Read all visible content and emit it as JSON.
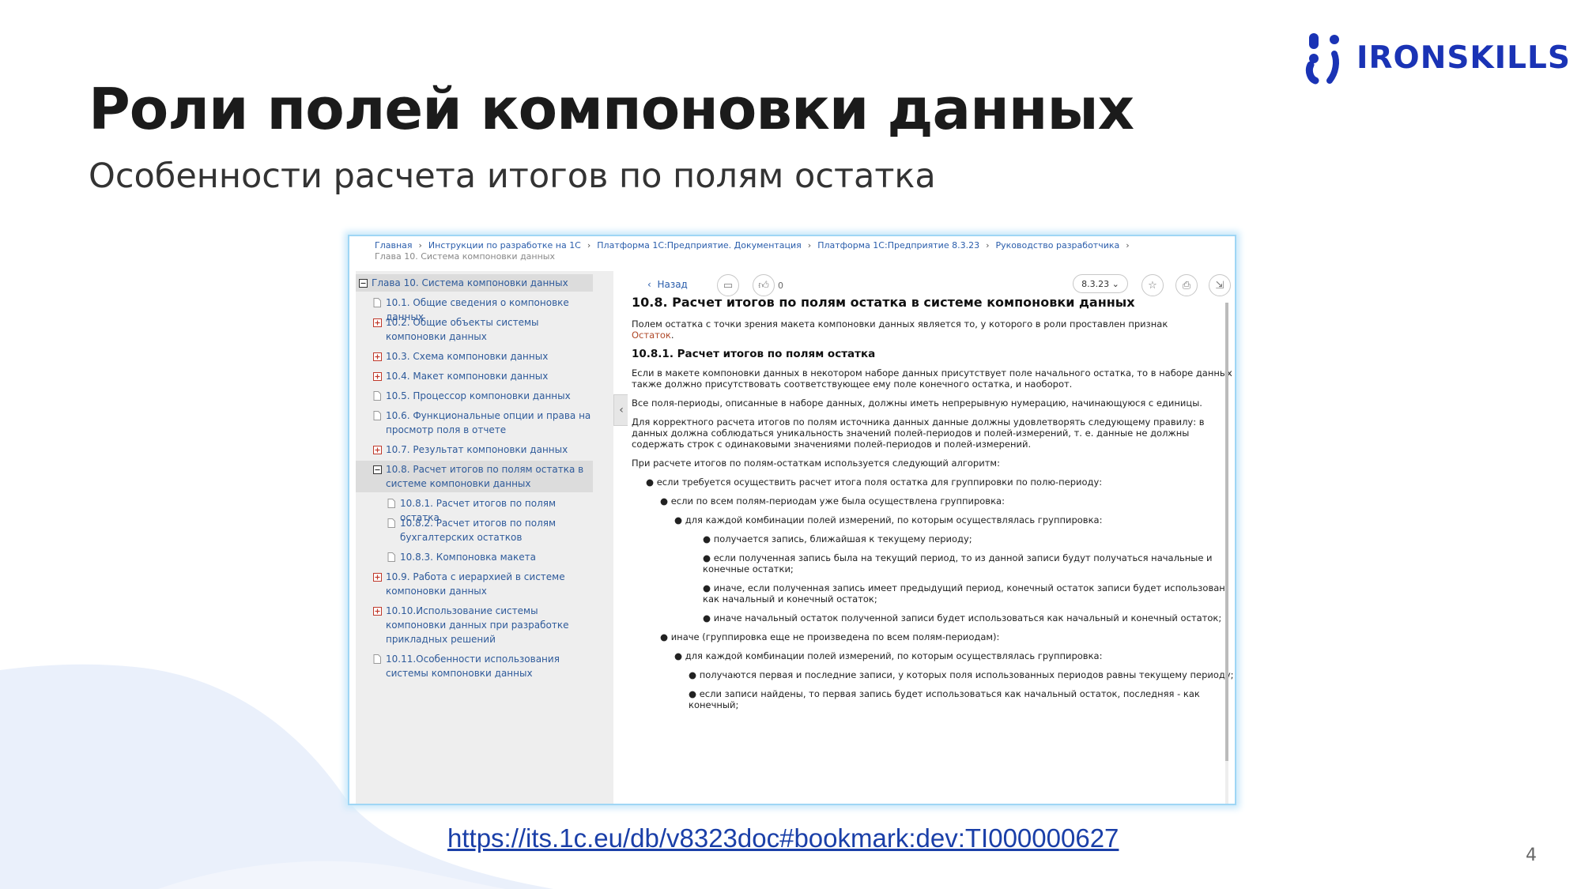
{
  "brand": {
    "name": "IRONSKILLS",
    "color": "#1a33b5"
  },
  "slide": {
    "title": "Роли полей компоновки данных",
    "subtitle": "Особенности расчета итогов по полям остатка",
    "link": "https://its.1c.eu/db/v8323doc#bookmark:dev:TI000000627",
    "page_number": "4"
  },
  "screenshot": {
    "breadcrumb": {
      "items": [
        "Главная",
        "Инструкции по разработке на 1С",
        "Платформа 1С:Предприятие. Документация",
        "Платформа 1С:Предприятие 8.3.23",
        "Руководство разработчика"
      ],
      "current": "Глава 10. Система компоновки данных"
    },
    "toc": [
      {
        "label": "Глава 10. Система компоновки данных",
        "icon": "minus-box-icon",
        "level": 0
      },
      {
        "label": "10.1. Общие сведения о компоновке данных",
        "icon": "page-icon",
        "level": 1
      },
      {
        "label": "10.2. Общие объекты системы компоновки данных",
        "icon": "plus-box-icon",
        "level": 1
      },
      {
        "label": "10.3. Схема компоновки данных",
        "icon": "plus-box-icon",
        "level": 1
      },
      {
        "label": "10.4. Макет компоновки данных",
        "icon": "plus-box-icon",
        "level": 1
      },
      {
        "label": "10.5. Процессор компоновки данных",
        "icon": "page-icon",
        "level": 1
      },
      {
        "label": "10.6. Функциональные опции и права на просмотр поля в отчете",
        "icon": "page-icon",
        "level": 1
      },
      {
        "label": "10.7. Результат компоновки данных",
        "icon": "plus-box-icon",
        "level": 1
      },
      {
        "label": "10.8. Расчет итогов по полям остатка в системе компоновки данных",
        "icon": "minus-box-icon",
        "level": 1
      },
      {
        "label": "10.8.1. Расчет итогов по полям остатка",
        "icon": "page-icon",
        "level": 2
      },
      {
        "label": "10.8.2. Расчет итогов по полям бухгалтерских остатков",
        "icon": "page-icon",
        "level": 2
      },
      {
        "label": "10.8.3. Компоновка макета",
        "icon": "page-icon",
        "level": 2
      },
      {
        "label": "10.9. Работа с иерархией в системе компоновки данных",
        "icon": "plus-box-icon",
        "level": 1
      },
      {
        "label": "10.10.Использование системы компоновки данных при разработке прикладных решений",
        "icon": "plus-box-icon",
        "level": 1
      },
      {
        "label": "10.11.Особенности использования системы компоновки данных",
        "icon": "page-icon",
        "level": 1
      }
    ],
    "toolbar": {
      "back": "Назад",
      "likes": "0",
      "version": "8.3.23"
    },
    "doc": {
      "h2": "10.8. Расчет итогов по полям остатка в системе компоновки данных",
      "p1": "Полем остатка с точки зрения макета компоновки данных является то, у которого в роли проставлен признак",
      "p1_hl": "Остаток",
      "h3": "10.8.1. Расчет итогов по полям остатка",
      "p2": "Если в макете компоновки данных в некотором наборе данных присутствует поле начального остатка, то в наборе данных также должно присутствовать соответствующее ему поле конечного остатка, и наоборот.",
      "p3": "Все поля-периоды, описанные в наборе данных, должны иметь непрерывную нумерацию, начинающуюся с единицы.",
      "p4": "Для корректного расчета итогов по полям источника данных данные должны удовлетворять следующему правилу: в данных должна соблюдаться уникальность значений полей-периодов и полей-измерений, т. е. данные не должны содержать строк с одинаковыми значениями полей-периодов и полей-измерений.",
      "p5": "При расчете итогов по полям-остаткам используется следующий алгоритм:",
      "b1": "если требуется осуществить расчет итога поля остатка для группировки по полю-периоду:",
      "b2": "если по всем полям-периодам уже была осуществлена группировка:",
      "b3": "для каждой комбинации полей измерений, по которым осуществлялась группировка:",
      "b4": "получается запись, ближайшая к текущему периоду;",
      "b5": "если полученная запись была на текущий период, то из данной записи будут получаться начальные и конечные остатки;",
      "b6": "иначе, если полученная запись имеет предыдущий период, конечный остаток записи будет использован как начальный и конечный остаток;",
      "b7": "иначе начальный остаток полученной записи будет использоваться как начальный и конечный остаток;",
      "b8": "иначе (группировка еще не произведена по всем полям-периодам):",
      "b9": "для каждой комбинации полей измерений, по которым осуществлялась группировка:",
      "b10": "получаются первая и последние записи, у которых поля использованных периодов равны текущему периоду;",
      "b11": "если записи найдены, то первая запись будет использоваться как начальный остаток, последняя - как конечный;"
    }
  }
}
